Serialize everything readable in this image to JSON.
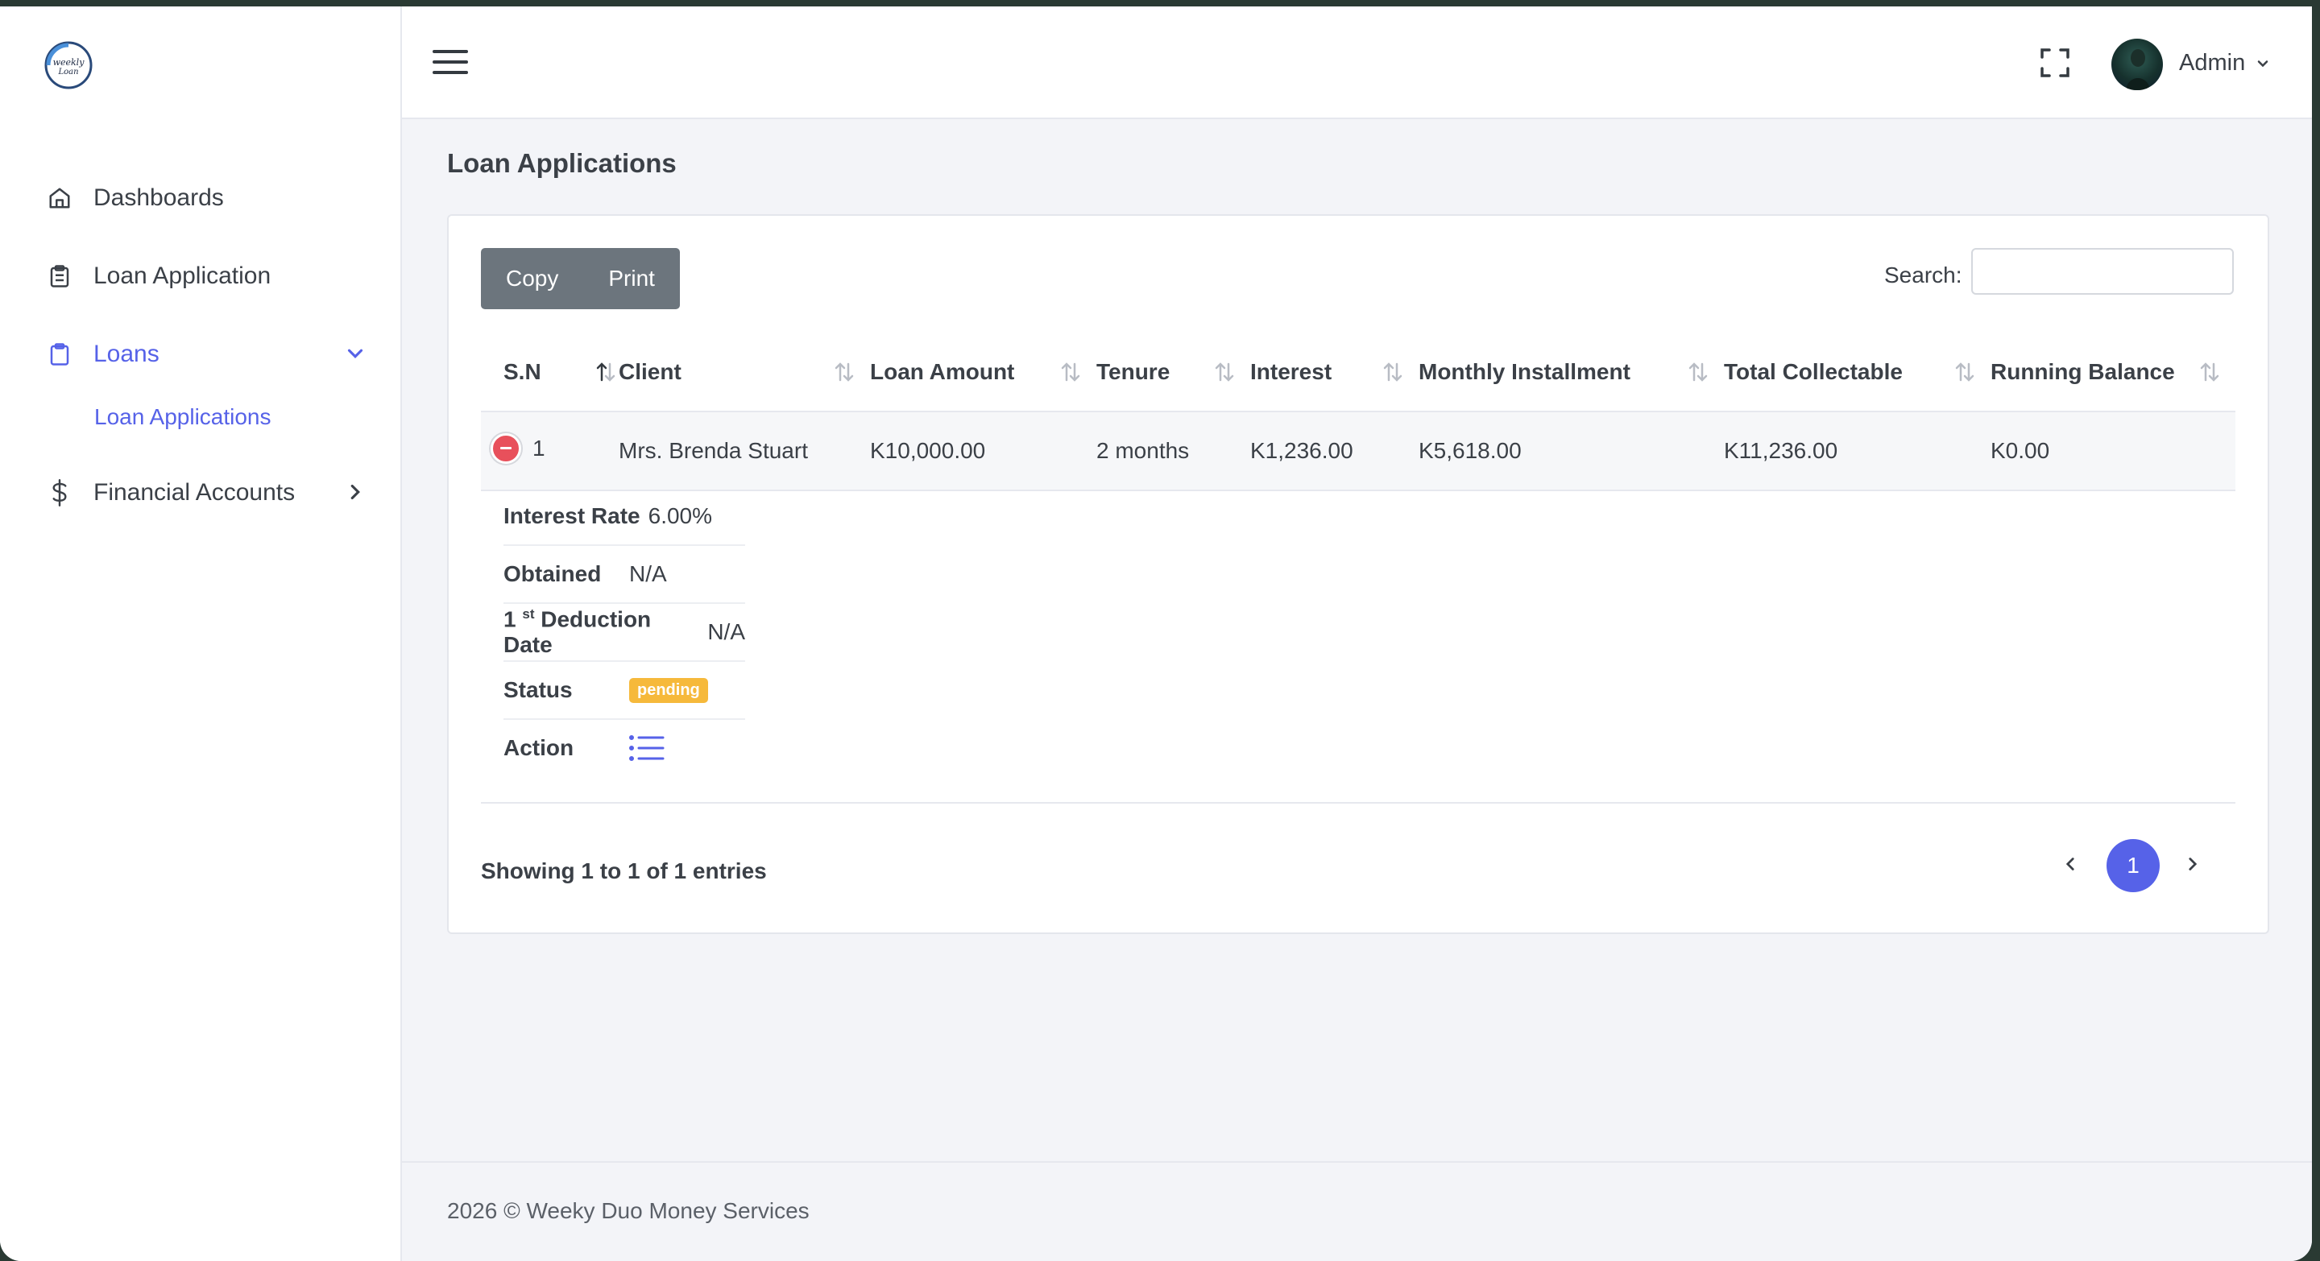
{
  "brand": {
    "logo_text": "weekly Loan",
    "logo_icon": "weekly-loan-logo"
  },
  "sidebar": {
    "items": [
      {
        "label": "Dashboards",
        "icon": "home-icon"
      },
      {
        "label": "Loan Application",
        "icon": "clipboard-list-icon"
      },
      {
        "label": "Loans",
        "icon": "clipboard-icon",
        "expanded": true
      },
      {
        "label": "Financial Accounts",
        "icon": "dollar-icon"
      }
    ],
    "sub_items": [
      {
        "label": "Loan Applications",
        "active": true
      }
    ]
  },
  "header": {
    "user_name": "Admin"
  },
  "page": {
    "title": "Loan Applications"
  },
  "toolbar": {
    "copy_label": "Copy",
    "print_label": "Print",
    "search_label": "Search:",
    "search_value": ""
  },
  "table": {
    "columns": [
      "S.N",
      "Client",
      "Loan Amount",
      "Tenure",
      "Interest",
      "Monthly Installment",
      "Total Collectable",
      "Running Balance"
    ],
    "rows": [
      {
        "sn": "1",
        "client": "Mrs. Brenda Stuart",
        "loan_amount": "K10,000.00",
        "tenure": "2 months",
        "interest": "K1,236.00",
        "monthly_installment": "K5,618.00",
        "total_collectable": "K11,236.00",
        "running_balance": "K0.00"
      }
    ],
    "details": {
      "interest_rate_label": "Interest Rate",
      "interest_rate_value": "6.00%",
      "obtained_label": "Obtained",
      "obtained_value": "N/A",
      "deduction_label_prefix": "1",
      "deduction_label_sup": "st",
      "deduction_label_suffix": "Deduction Date",
      "deduction_value": "N/A",
      "status_label": "Status",
      "status_value": "pending",
      "action_label": "Action"
    }
  },
  "pagination": {
    "info": "Showing 1 to 1 of 1 entries",
    "current_page": "1"
  },
  "footer": {
    "text": "2026 © Weeky Duo Money Services"
  },
  "colors": {
    "accent": "#5662e8",
    "pending": "#f6b93b",
    "danger": "#e8505b",
    "button_gray": "#6c757d"
  }
}
